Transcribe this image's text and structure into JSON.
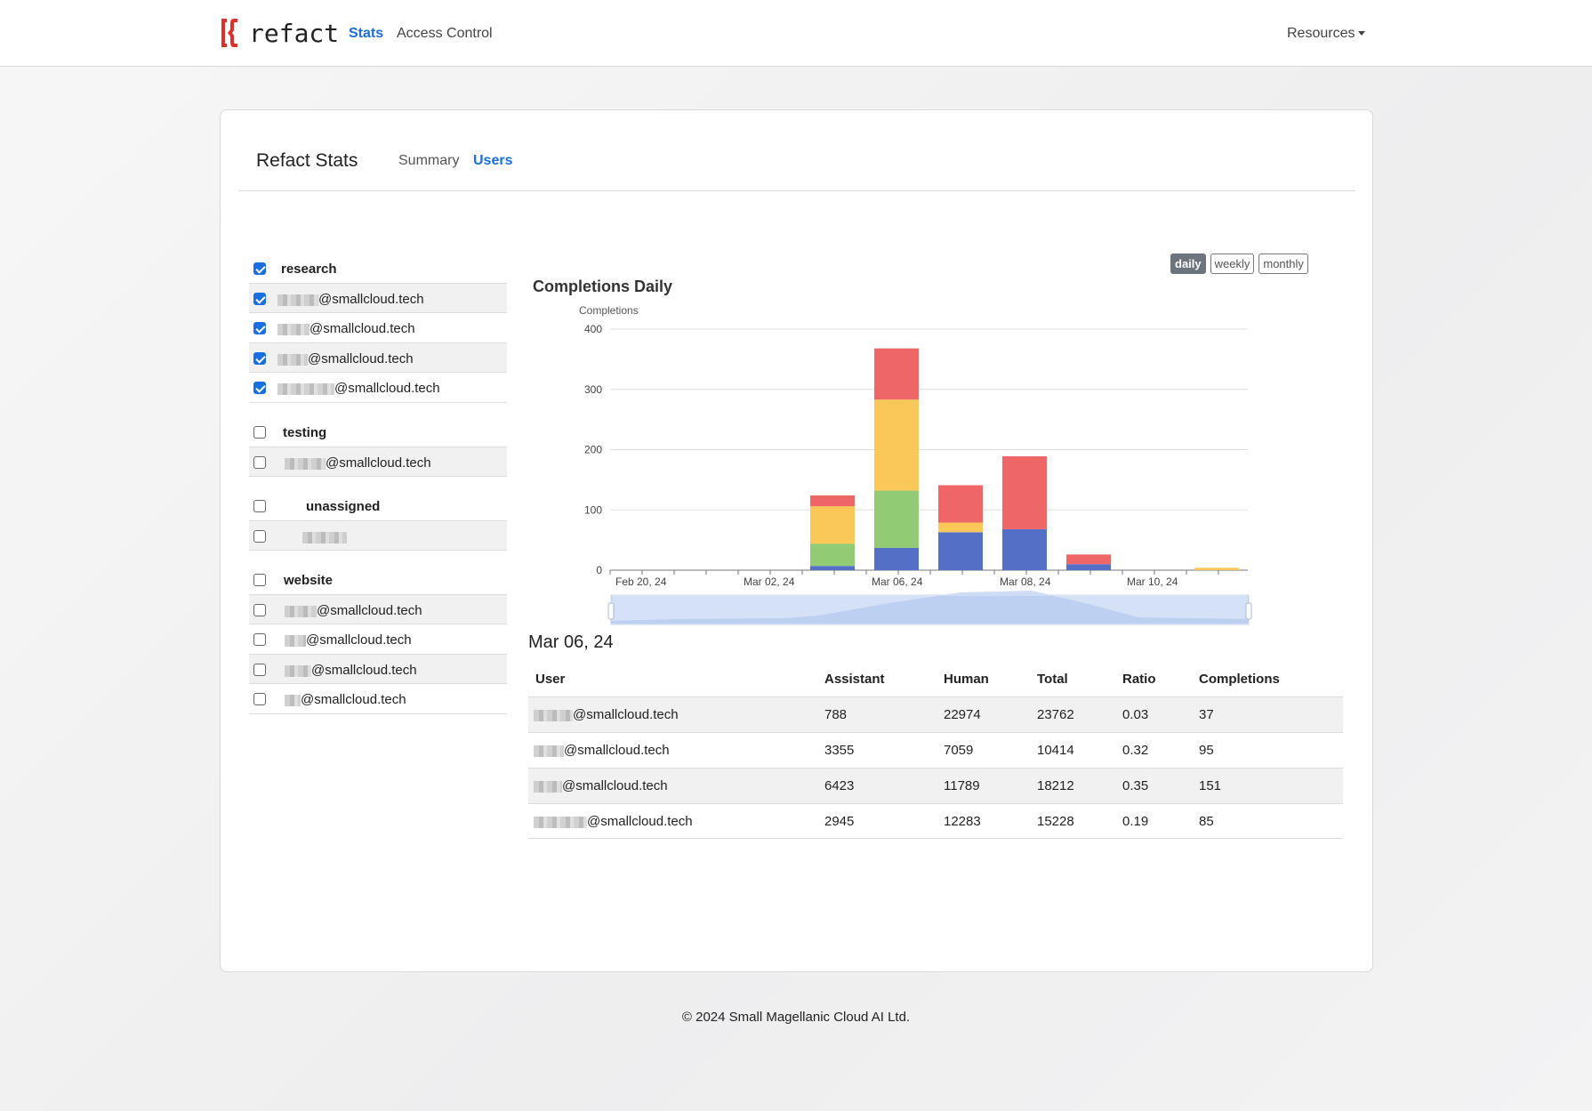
{
  "nav": {
    "brand": "refact",
    "links": [
      "Stats",
      "Access Control"
    ],
    "resources": "Resources"
  },
  "card": {
    "title": "Refact Stats",
    "tabs": [
      "Summary",
      "Users"
    ]
  },
  "groups": [
    {
      "name": "research",
      "checked": true,
      "users": [
        {
          "suffix": "@smallcloud.tech",
          "checked": true
        },
        {
          "suffix": "@smallcloud.tech",
          "checked": true
        },
        {
          "suffix": "@smallcloud.tech",
          "checked": true
        },
        {
          "suffix": "@smallcloud.tech",
          "checked": true
        }
      ]
    },
    {
      "name": "testing",
      "checked": false,
      "users": [
        {
          "suffix": "@smallcloud.tech",
          "checked": false
        }
      ]
    },
    {
      "name": "unassigned",
      "checked": false,
      "users": [
        {
          "suffix": "",
          "checked": false
        }
      ]
    },
    {
      "name": "website",
      "checked": false,
      "users": [
        {
          "suffix": "@smallcloud.tech",
          "checked": false
        },
        {
          "suffix": "@smallcloud.tech",
          "checked": false
        },
        {
          "suffix": "@smallcloud.tech",
          "checked": false
        },
        {
          "suffix": "@smallcloud.tech",
          "checked": false
        }
      ]
    }
  ],
  "period_buttons": [
    "daily",
    "weekly",
    "monthly"
  ],
  "chart_data": {
    "type": "bar",
    "title": "Completions Daily",
    "ylabel": "Completions",
    "xlabel": "",
    "ylim": [
      0,
      400
    ],
    "yticks": [
      0,
      100,
      200,
      300,
      400
    ],
    "xtick_labels": [
      "Feb 20, 24",
      "Mar 02, 24",
      "Mar 06, 24",
      "Mar 08, 24",
      "Mar 10, 24"
    ],
    "stacked": true,
    "categories": [
      "Mar 05, 24",
      "Mar 06, 24",
      "Mar 07, 24",
      "Mar 08, 24",
      "Mar 09, 24",
      "Mar 11, 24"
    ],
    "series": [
      {
        "color": "#5470c6",
        "values": [
          7,
          37,
          63,
          68,
          10,
          0
        ]
      },
      {
        "color": "#91cc75",
        "values": [
          37,
          95,
          0,
          0,
          0,
          0
        ]
      },
      {
        "color": "#fac858",
        "values": [
          62,
          151,
          16,
          0,
          0,
          4
        ]
      },
      {
        "color": "#ee6666",
        "values": [
          18,
          85,
          62,
          121,
          16,
          0
        ]
      }
    ]
  },
  "details": {
    "date": "Mar 06, 24",
    "columns": [
      "User",
      "Assistant",
      "Human",
      "Total",
      "Ratio",
      "Completions"
    ],
    "rows": [
      {
        "user": "@smallcloud.tech",
        "assistant": "788",
        "human": "22974",
        "total": "23762",
        "ratio": "0.03",
        "completions": "37"
      },
      {
        "user": "@smallcloud.tech",
        "assistant": "3355",
        "human": "7059",
        "total": "10414",
        "ratio": "0.32",
        "completions": "95"
      },
      {
        "user": "@smallcloud.tech",
        "assistant": "6423",
        "human": "11789",
        "total": "18212",
        "ratio": "0.35",
        "completions": "151"
      },
      {
        "user": "@smallcloud.tech",
        "assistant": "2945",
        "human": "12283",
        "total": "15228",
        "ratio": "0.19",
        "completions": "85"
      }
    ]
  },
  "footer": "© 2024 Small Magellanic Cloud AI Ltd.",
  "colors": {
    "accent": "#1a6fe0",
    "logo_red": "#e0302b"
  }
}
